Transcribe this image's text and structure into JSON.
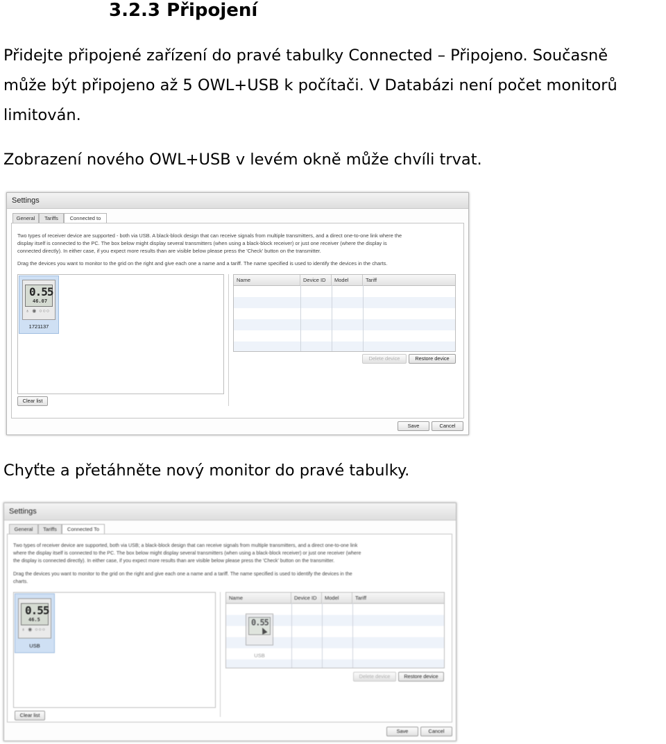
{
  "heading": "3.2.3 Připojení",
  "paragraphs": {
    "p1_line1": "Přidejte připojené zařízení do pravé tabulky Connected – Připojeno. Současně",
    "p1_line2": "může být připojeno až 5 OWL+USB k počítači. V Databázi není počet monitorů",
    "p1_line3": "limitován.",
    "p2": "Zobrazení nového OWL+USB v levém okně může chvíli trvat.",
    "p3": "Chyťte a přetáhněte nový monitor do pravé tabulky."
  },
  "screenshot1": {
    "title": "Settings",
    "tabs": [
      "General",
      "Tariffs",
      "Connected to"
    ],
    "description_lines": [
      "Two types of receiver device are supported - both via USB. A black-block design that can receive signals from multiple transmitters, and a direct one-to-one link where the",
      "display itself is connected to the PC. The box below might display several transmitters (when using a black-block receiver) or just one receiver (where the display is",
      "connected directly). In either case, if you expect more results than are visible below please press the 'Check' button on the transmitter."
    ],
    "drag_line": "Drag the devices you want to monitor to the grid on the right and give each one a name and a tariff. The name specified is used to identify the devices in the charts.",
    "device": {
      "big": "0.55",
      "small": "46.07",
      "icons": "♁ ◉ ○○○",
      "label": "1721137"
    },
    "columns": [
      "Name",
      "Device ID",
      "Model",
      "Tariff"
    ],
    "buttons": {
      "delete": "Delete device",
      "restore": "Restore device",
      "clear": "Clear list",
      "save": "Save",
      "cancel": "Cancel"
    }
  },
  "screenshot2": {
    "title": "Settings",
    "tabs": [
      "General",
      "Tariffs",
      "Connected To"
    ],
    "description_lines": [
      "Two types of receiver device are supported, both via USB; a black-block design that can receive signals from multiple transmitters, and a direct one-to-one link",
      "where the display itself is connected to the PC. The box below might display several transmitters (when using a black-block receiver) or just one receiver (where",
      "the display is connected directly). In either case, if you expect more results than are visible below please press the 'Check' button on the transmitter."
    ],
    "drag_lines": [
      "Drag the devices you want to monitor to the grid on the right and give each one a name and a tariff. The name specified is used to identify the devices in the",
      "charts."
    ],
    "device": {
      "big": "0.55",
      "small": "46.5",
      "icons": "♁ ◉ ○○○",
      "label": "USB"
    },
    "drag_device": {
      "big": "0.55",
      "label": "USB"
    },
    "columns": [
      "Name",
      "Device ID",
      "Model",
      "Tariff"
    ],
    "buttons": {
      "delete": "Delete device",
      "restore": "Restore device",
      "clear": "Clear list",
      "save": "Save",
      "cancel": "Cancel"
    }
  }
}
